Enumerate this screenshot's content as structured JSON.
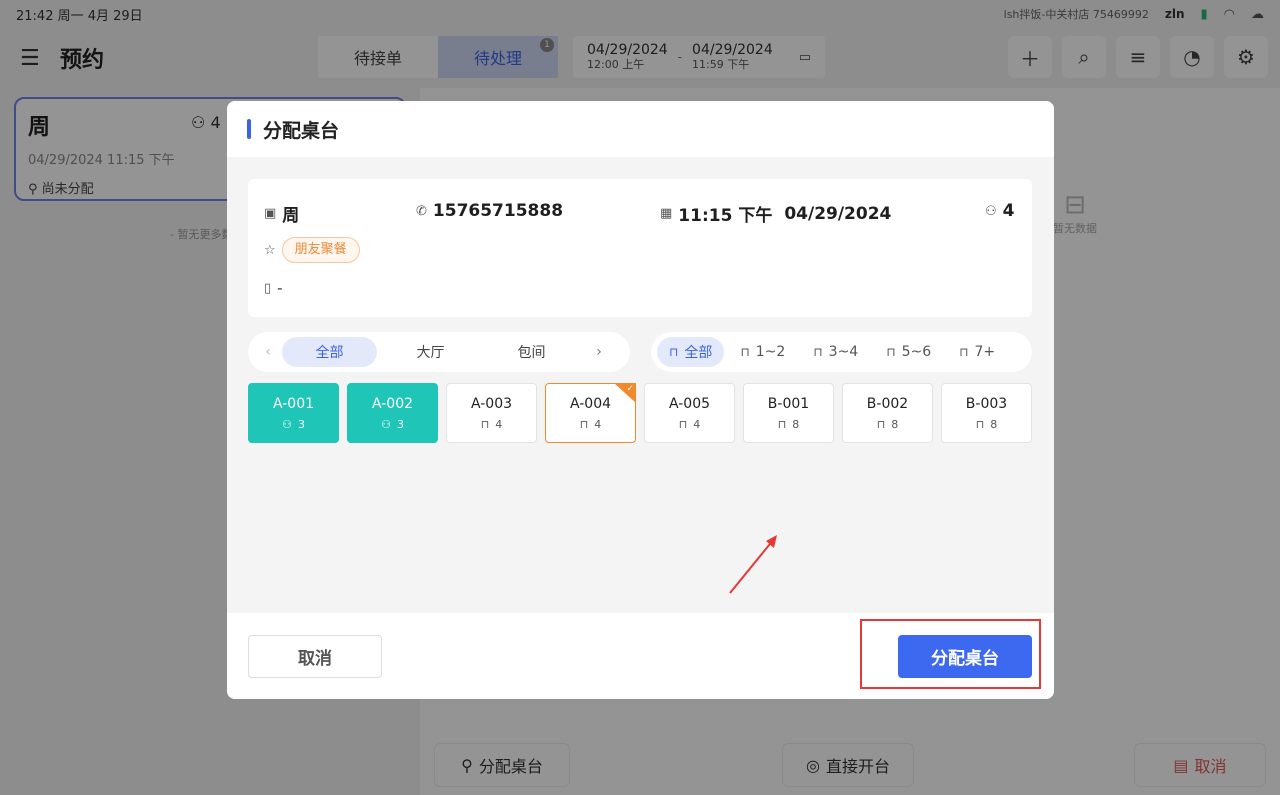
{
  "status_bar": {
    "time": "21:42 周一 4月 29日",
    "store": "lsh拌饭-中关村店 75469992",
    "user": "zln"
  },
  "header": {
    "title": "预约",
    "tabs": [
      {
        "label": "待接单"
      },
      {
        "label": "待处理",
        "badge": "1"
      }
    ],
    "date_range": {
      "start_date": "04/29/2024",
      "start_time": "12:00 上午",
      "end_date": "04/29/2024",
      "end_time": "11:59 下午",
      "separator": "-"
    }
  },
  "reservation_list": {
    "card": {
      "name": "周",
      "guests": "4",
      "datetime": "04/29/2024 11:15 下午",
      "status": "尚未分配"
    },
    "no_more": "- 暂无更多数据 -"
  },
  "detail": {
    "empty_text": "暂无数据"
  },
  "bottom_actions": {
    "assign": "分配桌台",
    "direct_open": "直接开台",
    "cancel": "取消"
  },
  "modal": {
    "title": "分配桌台",
    "info": {
      "name": "周",
      "phone": "15765715888",
      "time": "11:15 下午",
      "date": "04/29/2024",
      "guests": "4",
      "tag": "朋友聚餐",
      "note": "-"
    },
    "area_filters": [
      {
        "label": "全部",
        "active": true
      },
      {
        "label": "大厅",
        "active": false
      },
      {
        "label": "包间",
        "active": false
      }
    ],
    "seat_filters": [
      {
        "label": "全部",
        "active": true
      },
      {
        "label": "1~2",
        "active": false
      },
      {
        "label": "3~4",
        "active": false
      },
      {
        "label": "5~6",
        "active": false
      },
      {
        "label": "7+",
        "active": false
      }
    ],
    "tables": [
      {
        "code": "A-001",
        "seats": "3",
        "state": "occupied"
      },
      {
        "code": "A-002",
        "seats": "3",
        "state": "occupied"
      },
      {
        "code": "A-003",
        "seats": "4",
        "state": "free"
      },
      {
        "code": "A-004",
        "seats": "4",
        "state": "selected"
      },
      {
        "code": "A-005",
        "seats": "4",
        "state": "free"
      },
      {
        "code": "B-001",
        "seats": "8",
        "state": "free"
      },
      {
        "code": "B-002",
        "seats": "8",
        "state": "free"
      },
      {
        "code": "B-003",
        "seats": "8",
        "state": "free"
      }
    ],
    "cancel_label": "取消",
    "confirm_label": "分配桌台"
  },
  "colors": {
    "primary": "#3d68f0",
    "occupied": "#1fc5b7",
    "selected": "#f08a2b",
    "annotation": "#e53935"
  }
}
